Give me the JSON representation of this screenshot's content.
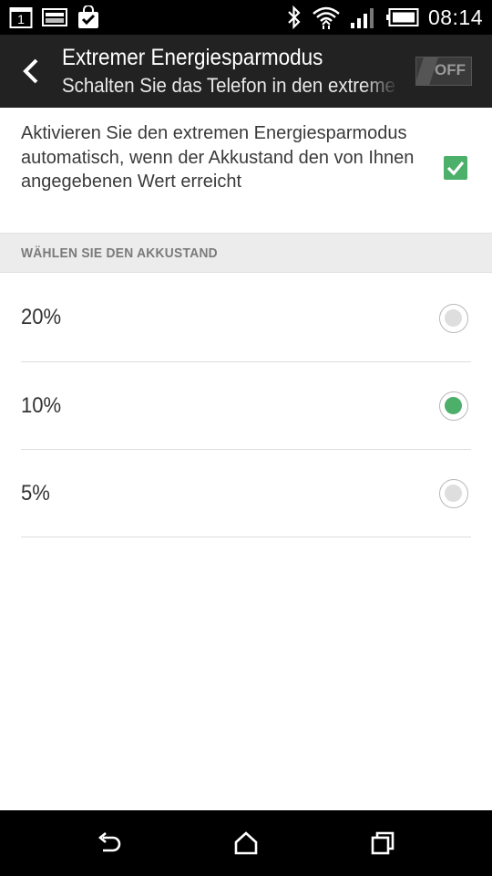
{
  "status_bar": {
    "notification_icons": [
      "calendar-icon",
      "card-icon",
      "shopping-bag-check-icon"
    ],
    "calendar_day": "1",
    "system_icons": [
      "bluetooth-icon",
      "wifi-icon",
      "signal-icon",
      "battery-icon"
    ],
    "time": "08:14"
  },
  "action_bar": {
    "title": "Extremer Energiesparmodus",
    "subtitle": "Schalten Sie das Telefon in den extremen Energiesparmodus",
    "toggle_label": "OFF",
    "toggle_state": "off"
  },
  "auto_option": {
    "text": "Aktivieren Sie den extremen Energiesparmodus automatisch, wenn der Akkustand den von Ihnen angegebenen Wert erreicht",
    "checked": true
  },
  "section": {
    "header": "WÄHLEN SIE DEN AKKUSTAND"
  },
  "battery_levels": [
    {
      "label": "20%",
      "selected": false
    },
    {
      "label": "10%",
      "selected": true
    },
    {
      "label": "5%",
      "selected": false
    }
  ],
  "nav_bar": {
    "buttons": [
      "back-icon",
      "home-icon",
      "recent-apps-icon"
    ]
  },
  "colors": {
    "accent": "#4caf6a",
    "action_bar": "#222222",
    "section_bg": "#ececec"
  }
}
